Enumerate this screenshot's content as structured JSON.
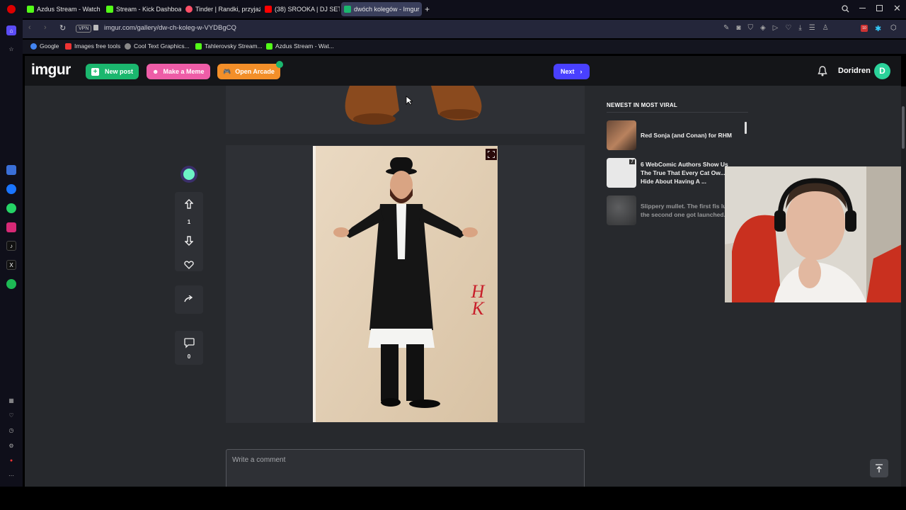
{
  "browser": {
    "tabs": [
      {
        "label": "Azdus Stream - Watch",
        "active": false,
        "color": "#53fc18"
      },
      {
        "label": "Stream - Kick Dashboard",
        "active": false,
        "color": "#53fc18"
      },
      {
        "label": "Tinder | Randki, przyjaźń,",
        "active": false,
        "color": "#fd5068"
      },
      {
        "label": "(38) SROOKA | DJ SET",
        "active": false,
        "color": "#ff0000"
      },
      {
        "label": "dwóch kolegów - Imgur",
        "active": true,
        "color": "#1bb76e"
      }
    ],
    "vpn_label": "VPN",
    "url": "imgur.com/gallery/dw-ch-koleg-w-VYDBgCQ",
    "bookmarks": [
      {
        "label": "Google",
        "color": "#4285f4"
      },
      {
        "label": "Images free tools",
        "color": "#e33"
      },
      {
        "label": "Cool Text Graphics...",
        "color": "#888"
      },
      {
        "label": "Tahlerovsky Stream...",
        "color": "#53fc18"
      },
      {
        "label": "Azdus Stream - Wat...",
        "color": "#53fc18"
      }
    ],
    "badge_count": "10"
  },
  "imgur": {
    "logo": "imgur",
    "new_post": "New post",
    "make_meme": "Make a Meme",
    "open_arcade": "Open Arcade",
    "next": "Next",
    "username": "Doridren",
    "avatar_letter": "D",
    "brand_green": "#1bb76e",
    "brand_blue": "#4940ff"
  },
  "post": {
    "upvotes": "1",
    "comments": "0",
    "watermark": "HK",
    "comment_placeholder": "Write a comment"
  },
  "viral": {
    "heading": "NEWEST IN MOST VIRAL",
    "items": [
      {
        "title": "Red Sonja (and Conan) for RHM"
      },
      {
        "title": "6  WebComic Authors Show Us The True That Every Cat Ow... Hide About Having A ...",
        "count": "7"
      },
      {
        "title": "Slippery mullet. The first fis lucky, the second one got launched."
      }
    ]
  }
}
